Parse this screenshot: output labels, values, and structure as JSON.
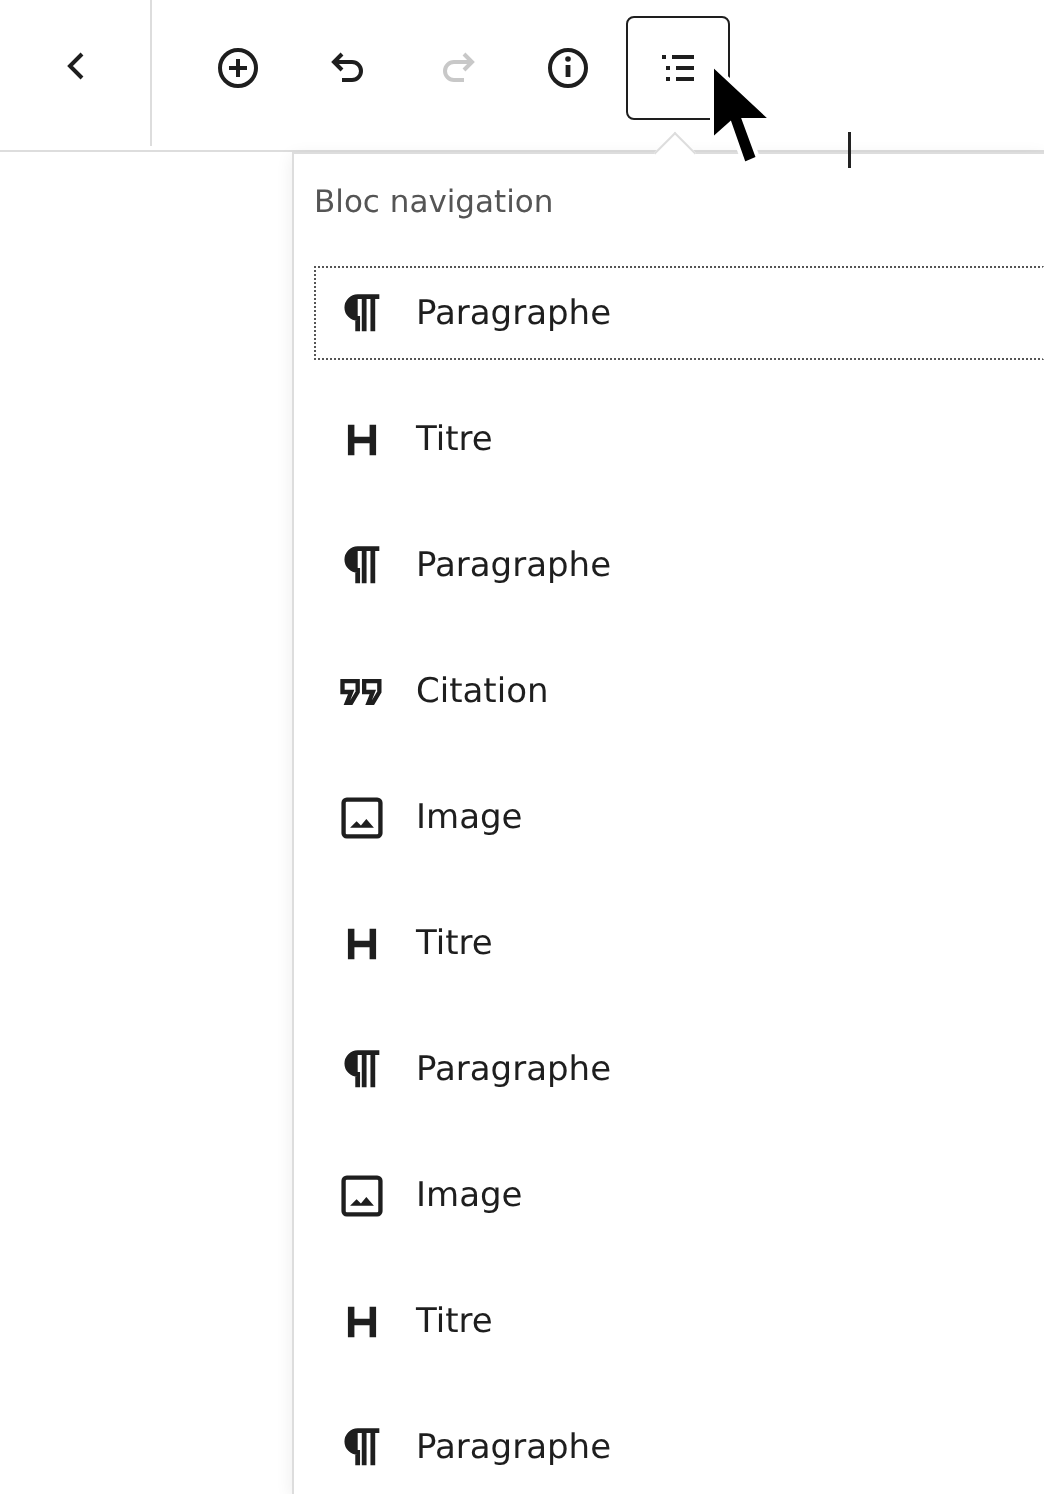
{
  "toolbar": {
    "buttons": [
      {
        "kind": "back",
        "disabled": false,
        "pressed": false
      },
      {
        "kind": "inserter",
        "disabled": false,
        "pressed": false
      },
      {
        "kind": "undo",
        "disabled": false,
        "pressed": false
      },
      {
        "kind": "redo",
        "disabled": true,
        "pressed": false
      },
      {
        "kind": "info",
        "disabled": false,
        "pressed": false
      },
      {
        "kind": "list",
        "disabled": false,
        "pressed": true
      }
    ]
  },
  "block_navigation": {
    "title": "Bloc navigation",
    "items": [
      {
        "kind": "paragraph",
        "label": "Paragraphe",
        "selected": true
      },
      {
        "kind": "heading",
        "label": "Titre",
        "selected": false
      },
      {
        "kind": "paragraph",
        "label": "Paragraphe",
        "selected": false
      },
      {
        "kind": "quote",
        "label": "Citation",
        "selected": false
      },
      {
        "kind": "image",
        "label": "Image",
        "selected": false
      },
      {
        "kind": "heading",
        "label": "Titre",
        "selected": false
      },
      {
        "kind": "paragraph",
        "label": "Paragraphe",
        "selected": false
      },
      {
        "kind": "image",
        "label": "Image",
        "selected": false
      },
      {
        "kind": "heading",
        "label": "Titre",
        "selected": false
      },
      {
        "kind": "paragraph",
        "label": "Paragraphe",
        "selected": false
      }
    ]
  }
}
